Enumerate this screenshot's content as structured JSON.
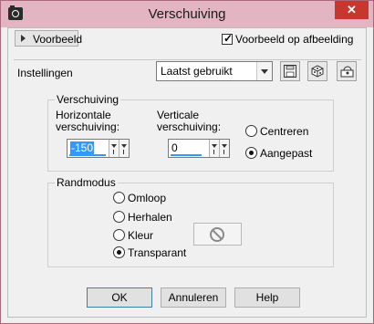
{
  "window": {
    "title": "Verschuiving"
  },
  "preview": {
    "label": "Voorbeeld",
    "checkbox_label": "Voorbeeld op afbeelding",
    "checked": true
  },
  "settings": {
    "label": "Instellingen",
    "preset_value": "Laatst gebruikt"
  },
  "offset": {
    "group_title": "Verschuiving",
    "horizontal_label_1": "Horizontale",
    "horizontal_label_2": "verschuiving:",
    "horizontal_value": "-150",
    "vertical_label_1": "Verticale",
    "vertical_label_2": "verschuiving:",
    "vertical_value": "0",
    "options": [
      "Centreren",
      "Aangepast"
    ],
    "selected": "Aangepast"
  },
  "edge_mode": {
    "group_title": "Randmodus",
    "options": [
      "Omloop",
      "Herhalen",
      "Kleur",
      "Transparant"
    ],
    "selected": "Transparant"
  },
  "buttons": {
    "ok": "OK",
    "cancel": "Annuleren",
    "help": "Help"
  },
  "icons": [
    "camera-icon",
    "close-icon",
    "save-preset-icon",
    "randomize-icon",
    "reset-icon",
    "no-color-icon"
  ]
}
